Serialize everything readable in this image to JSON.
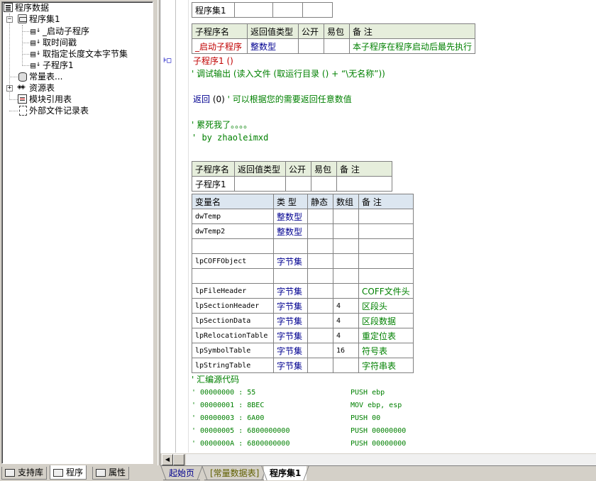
{
  "tree": {
    "root": "程序数据",
    "assembly": "程序集1",
    "subs": [
      "_启动子程序",
      "取时间戳",
      "取指定长度文本字节集",
      "子程序1"
    ],
    "constants": "常量表...",
    "resources": "资源表",
    "modules": "模块引用表",
    "external": "外部文件记录表"
  },
  "left_tabs": [
    "支持库",
    "程序",
    "属性"
  ],
  "bottom_tabs": [
    "起始页",
    "[常量数据表]",
    "程序集1"
  ],
  "top_table": {
    "name_cell": "程序集1"
  },
  "startup_table": {
    "headers": [
      "子程序名",
      "返回值类型",
      "公开",
      "易包",
      "备 注"
    ],
    "row": [
      "_启动子程序",
      "整数型",
      "",
      "",
      "本子程序在程序启动后最先执行"
    ]
  },
  "code": {
    "sub_call": "子程序1 ()",
    "debug_line": "' 调试输出 (读入文件 (取运行目录 () + “\\无名称”))",
    "return_kw": "返回",
    "return_val": "(0)",
    "return_comment": "' 可以根据您的需要返回任意数值",
    "tired": "' 累死我了。。。。",
    "by": "' by zhaoleimxd"
  },
  "sub1_table": {
    "headers": [
      "子程序名",
      "返回值类型",
      "公开",
      "易包",
      "备 注"
    ],
    "row": [
      "子程序1",
      "",
      "",
      "",
      ""
    ]
  },
  "var_table": {
    "headers": [
      "变量名",
      "类 型",
      "静态",
      "数组",
      "备 注"
    ],
    "rows": [
      [
        "dwTemp",
        "整数型",
        "",
        "",
        ""
      ],
      [
        "dwTemp2",
        "整数型",
        "",
        "",
        ""
      ],
      [
        "",
        "",
        "",
        "",
        ""
      ],
      [
        "lpCOFFObject",
        "字节集",
        "",
        "",
        ""
      ],
      [
        "",
        "",
        "",
        "",
        ""
      ],
      [
        "lpFileHeader",
        "字节集",
        "",
        "",
        "COFF文件头"
      ],
      [
        "lpSectionHeader",
        "字节集",
        "",
        "4",
        "区段头"
      ],
      [
        "lpSectionData",
        "字节集",
        "",
        "4",
        "区段数据"
      ],
      [
        "lpRelocationTable",
        "字节集",
        "",
        "4",
        "重定位表"
      ],
      [
        "lpSymbolTable",
        "字节集",
        "",
        "16",
        "符号表"
      ],
      [
        "lpStringTable",
        "字节集",
        "",
        "",
        "字符串表"
      ]
    ]
  },
  "asm": {
    "title": "' 汇编源代码",
    "lines": [
      [
        "' 00000000 : 55",
        "PUSH ebp"
      ],
      [
        "' 00000001 : 8BEC",
        "MOV ebp, esp"
      ],
      [
        "' 00000003 : 6A00",
        "PUSH 00"
      ],
      [
        "' 00000005 : 6800000000",
        "PUSH 00000000"
      ],
      [
        "' 0000000A : 6800000000",
        "PUSH 00000000"
      ]
    ]
  },
  "colors": {
    "type_blue": "#000090",
    "comment_green": "#008000",
    "sub_red": "#c00000"
  }
}
